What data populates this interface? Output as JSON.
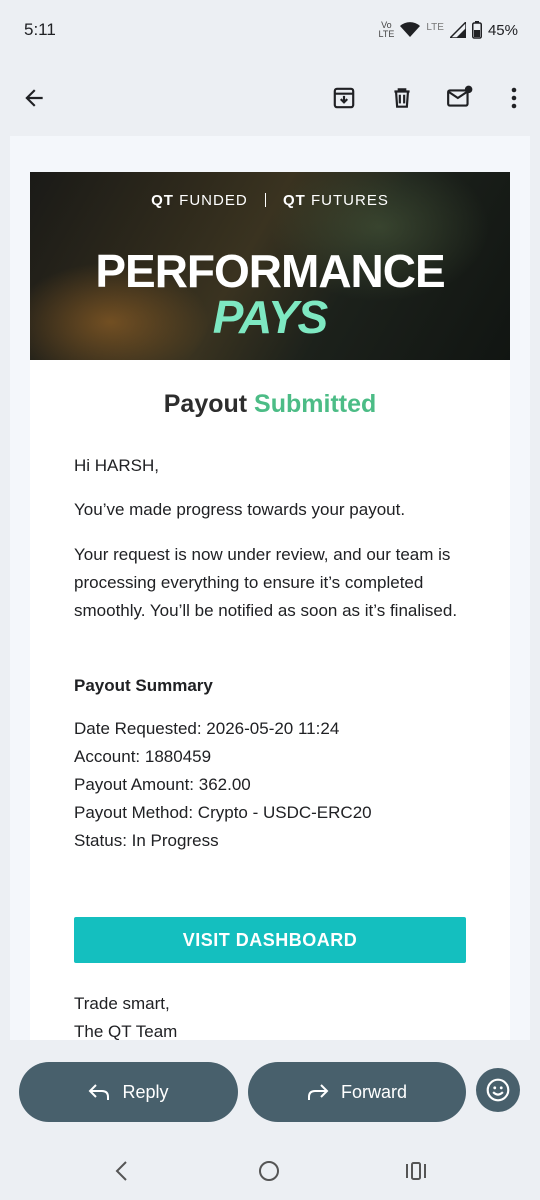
{
  "status_bar": {
    "time": "5:11",
    "network_top": "Vo",
    "network_bottom": "LTE",
    "lte": "LTE",
    "battery": "45%"
  },
  "toolbar": {
    "icons": [
      "back-arrow-icon",
      "archive-icon",
      "delete-icon",
      "mark-unread-icon",
      "more-vert-icon"
    ]
  },
  "banner": {
    "brand1_bold": "QT",
    "brand1_rest": "FUNDED",
    "brand2_bold": "QT",
    "brand2_rest": "FUTURES",
    "headline": "PERFORMANCE",
    "subheadline": "PAYS"
  },
  "email": {
    "title_plain": "Payout",
    "title_accent": "Submitted",
    "greeting": "Hi HARSH,",
    "para1": "You’ve made progress towards your payout.",
    "para2": "Your request is now under review, and our team is processing everything to ensure it’s completed smoothly. You’ll be notified as soon as it’s finalised.",
    "summary_heading": "Payout Summary",
    "summary": [
      "Date Requested: 2026-05-20 11:24",
      "Account: 1880459",
      "Payout Amount: 362.00",
      "Payout Method: Crypto - USDC-ERC20",
      "Status: In Progress"
    ],
    "cta": "VISIT DASHBOARD",
    "signoff1": "Trade smart,",
    "signoff2": "The QT Team"
  },
  "actions": {
    "reply": "Reply",
    "forward": "Forward"
  },
  "colors": {
    "accent_green": "#4cbc86",
    "cta_teal": "#14bfbf",
    "pill": "#48606c"
  }
}
